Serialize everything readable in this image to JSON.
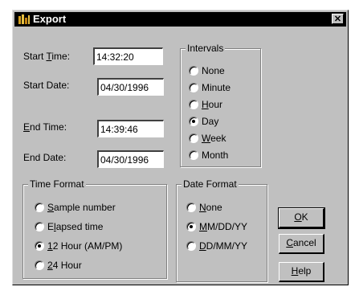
{
  "window": {
    "title": "Export",
    "close_glyph": "✕"
  },
  "fields": {
    "start_time": {
      "label_pre": "Start ",
      "label_u": "T",
      "label_post": "ime:",
      "value": "14:32:20"
    },
    "start_date": {
      "label": "Start Date:",
      "value": "04/30/1996"
    },
    "end_time": {
      "label_u": "E",
      "label_post": "nd Time:",
      "value": "14:39:46"
    },
    "end_date": {
      "label": "End Date:",
      "value": "04/30/1996"
    }
  },
  "intervals": {
    "legend": "Intervals",
    "options": [
      {
        "pre": "None",
        "u": "",
        "post": "",
        "checked": false
      },
      {
        "pre": "Minute",
        "u": "",
        "post": "",
        "checked": false
      },
      {
        "pre": "",
        "u": "H",
        "post": "our",
        "checked": false
      },
      {
        "pre": "Day",
        "u": "",
        "post": "",
        "checked": true
      },
      {
        "pre": "",
        "u": "W",
        "post": "eek",
        "checked": false
      },
      {
        "pre": "Month",
        "u": "",
        "post": "",
        "checked": false
      }
    ]
  },
  "time_format": {
    "legend": "Time Format",
    "options": [
      {
        "pre": "",
        "u": "S",
        "post": "ample number",
        "checked": false
      },
      {
        "pre": "E",
        "u": "l",
        "post": "apsed time",
        "checked": false
      },
      {
        "pre": "",
        "u": "1",
        "post": "2 Hour (AM/PM)",
        "checked": true
      },
      {
        "pre": "",
        "u": "2",
        "post": "4 Hour",
        "checked": false
      }
    ]
  },
  "date_format": {
    "legend": "Date Format",
    "options": [
      {
        "pre": "",
        "u": "N",
        "post": "one",
        "checked": false
      },
      {
        "pre": "",
        "u": "M",
        "post": "M/DD/YY",
        "checked": true
      },
      {
        "pre": "",
        "u": "D",
        "post": "D/MM/YY",
        "checked": false
      }
    ]
  },
  "buttons": {
    "ok": {
      "u": "O",
      "post": "K"
    },
    "cancel": {
      "u": "C",
      "post": "ancel"
    },
    "help": {
      "u": "H",
      "post": "elp"
    }
  }
}
